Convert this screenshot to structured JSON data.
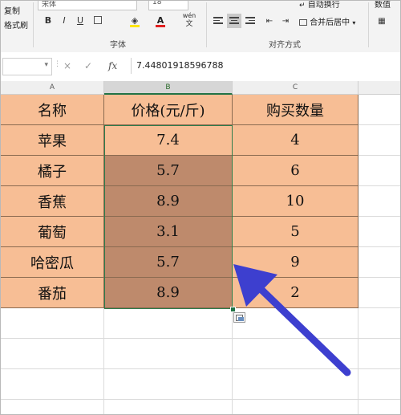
{
  "ribbon": {
    "copy_label": "复制",
    "format_painter_label": "格式刷",
    "font_name": "宋体",
    "font_size": "18",
    "font_group_label": "字体",
    "align_group_label": "对齐方式",
    "wrap_text_label": "自动换行",
    "merge_center_label": "合并后居中",
    "number_label": "数值",
    "bold_label": "B",
    "italic_label": "I",
    "underline_label": "U",
    "font_color_label": "A",
    "phonetic_label": "wén"
  },
  "formula_bar": {
    "cancel_icon": "×",
    "enter_icon": "✓",
    "fx_label": "fx",
    "value": "7.44801918596788"
  },
  "columns": [
    "A",
    "B",
    "C"
  ],
  "table": {
    "header": [
      "名称",
      "价格(元/斤)",
      "购买数量"
    ],
    "rows": [
      [
        "苹果",
        "7.4",
        "4"
      ],
      [
        "橘子",
        "5.7",
        "6"
      ],
      [
        "香蕉",
        "8.9",
        "10"
      ],
      [
        "葡萄",
        "3.1",
        "5"
      ],
      [
        "哈密瓜",
        "5.7",
        "9"
      ],
      [
        "番茄",
        "8.9",
        "2"
      ]
    ]
  },
  "colors": {
    "cell_fill": "#f7be95",
    "selected_fill": "#be8a6c",
    "selection_border": "#2f7d4b",
    "arrow": "#3d3fcf"
  }
}
